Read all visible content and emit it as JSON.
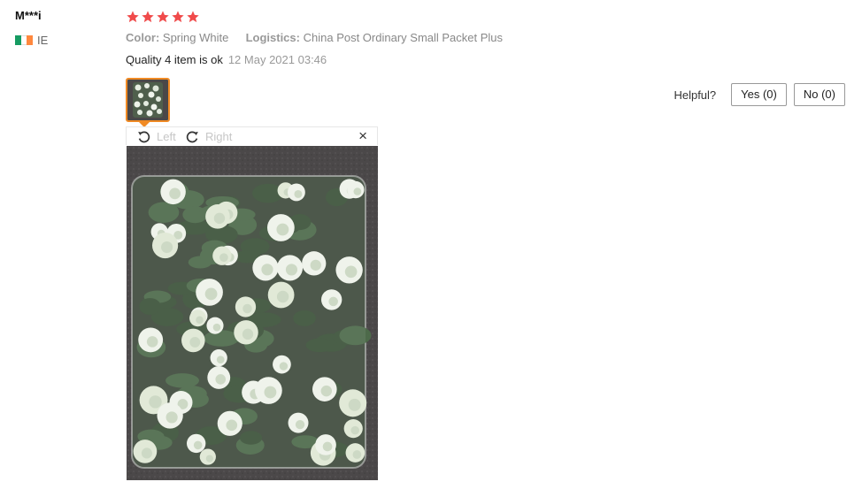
{
  "reviewer": {
    "name": "M***i",
    "country_code": "IE",
    "flag_colors": [
      "#169B62",
      "#FFFFFF",
      "#FF883E"
    ]
  },
  "review": {
    "rating": 5,
    "star_color": "#f04b4b",
    "attributes": [
      {
        "label": "Color:",
        "value": "Spring White"
      },
      {
        "label": "Logistics:",
        "value": "China Post Ordinary Small Packet Plus"
      }
    ],
    "text": "Quality 4 item is ok",
    "date": "12 May 2021 03:46"
  },
  "image_viewer": {
    "rotate_left_label": "Left",
    "rotate_right_label": "Right",
    "close_label": "×"
  },
  "helpful": {
    "label": "Helpful?",
    "yes_label": "Yes (0)",
    "no_label": "No (0)"
  },
  "accent_color": "#f08a24"
}
